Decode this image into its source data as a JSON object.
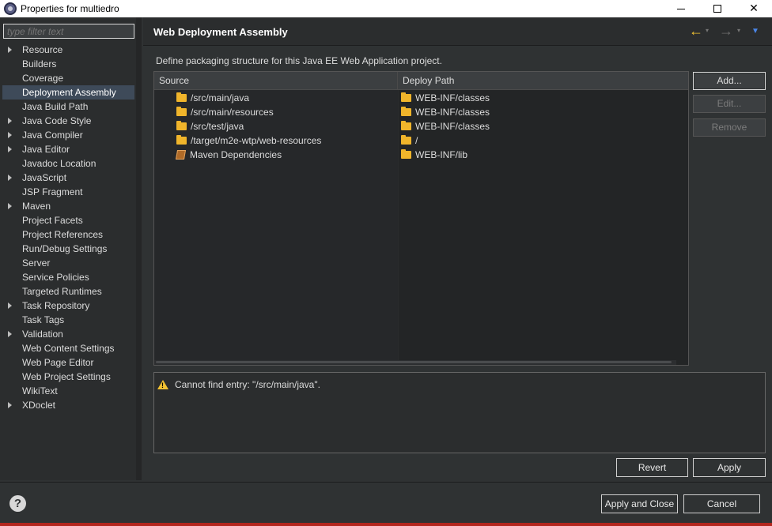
{
  "window": {
    "title": "Properties for multiedro",
    "controls": {
      "minimize": "minimize-icon",
      "maximize": "maximize-icon",
      "close": "✕"
    }
  },
  "sidebar": {
    "filter_placeholder": "type filter text",
    "items": [
      {
        "label": "Resource",
        "expandable": true
      },
      {
        "label": "Builders",
        "expandable": false
      },
      {
        "label": "Coverage",
        "expandable": false
      },
      {
        "label": "Deployment Assembly",
        "expandable": false,
        "selected": true
      },
      {
        "label": "Java Build Path",
        "expandable": false
      },
      {
        "label": "Java Code Style",
        "expandable": true
      },
      {
        "label": "Java Compiler",
        "expandable": true
      },
      {
        "label": "Java Editor",
        "expandable": true
      },
      {
        "label": "Javadoc Location",
        "expandable": false
      },
      {
        "label": "JavaScript",
        "expandable": true
      },
      {
        "label": "JSP Fragment",
        "expandable": false
      },
      {
        "label": "Maven",
        "expandable": true
      },
      {
        "label": "Project Facets",
        "expandable": false
      },
      {
        "label": "Project References",
        "expandable": false
      },
      {
        "label": "Run/Debug Settings",
        "expandable": false
      },
      {
        "label": "Server",
        "expandable": false
      },
      {
        "label": "Service Policies",
        "expandable": false
      },
      {
        "label": "Targeted Runtimes",
        "expandable": false
      },
      {
        "label": "Task Repository",
        "expandable": true
      },
      {
        "label": "Task Tags",
        "expandable": false
      },
      {
        "label": "Validation",
        "expandable": true
      },
      {
        "label": "Web Content Settings",
        "expandable": false
      },
      {
        "label": "Web Page Editor",
        "expandable": false
      },
      {
        "label": "Web Project Settings",
        "expandable": false
      },
      {
        "label": "WikiText",
        "expandable": false
      },
      {
        "label": "XDoclet",
        "expandable": true
      }
    ]
  },
  "page": {
    "title": "Web Deployment Assembly",
    "description": "Define packaging structure for this Java EE Web Application project.",
    "nav": {
      "back": "←",
      "forward": "→",
      "dropdown": "▾",
      "menu": "▼"
    }
  },
  "table": {
    "columns": [
      "Source",
      "Deploy Path"
    ],
    "rows": [
      {
        "source": "/src/main/java",
        "deploy": "WEB-INF/classes",
        "icon": "folder-icon"
      },
      {
        "source": "/src/main/resources",
        "deploy": "WEB-INF/classes",
        "icon": "folder-icon"
      },
      {
        "source": "/src/test/java",
        "deploy": "WEB-INF/classes",
        "icon": "folder-icon"
      },
      {
        "source": "/target/m2e-wtp/web-resources",
        "deploy": "/",
        "icon": "folder-icon"
      },
      {
        "source": "Maven Dependencies",
        "deploy": "WEB-INF/lib",
        "icon": "library-icon"
      }
    ]
  },
  "buttons": {
    "add": "Add...",
    "edit": "Edit...",
    "remove": "Remove",
    "revert": "Revert",
    "apply": "Apply",
    "apply_and_close": "Apply and Close",
    "cancel": "Cancel"
  },
  "message": {
    "text": "Cannot find entry: \"/src/main/java\".",
    "icon": "warning-icon"
  },
  "footer": {
    "help": "?"
  },
  "colors": {
    "accent_nav_back": "#f2c232",
    "warning": "#f2c232",
    "folder": "#f0b52b",
    "selection": "#3e4a59",
    "menu_arrow": "#4a86e8"
  }
}
